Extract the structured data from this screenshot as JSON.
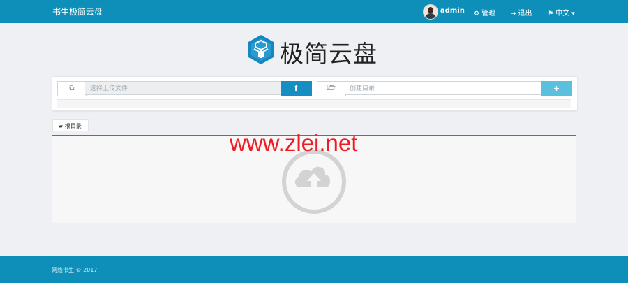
{
  "navbar": {
    "brand": "书生极简云盘",
    "user": "admin",
    "manage": "管理",
    "logout": "退出",
    "language": "中文"
  },
  "logo": {
    "title": "极简云盘"
  },
  "upload": {
    "file_placeholder": "选择上传文件",
    "dir_placeholder": "创建目录"
  },
  "tabs": {
    "root": "根目录"
  },
  "watermark": "www.zlei.net",
  "footer": {
    "text": "网络书生 © 2017"
  },
  "colors": {
    "navbar": "#0e8fb9",
    "upload_button": "#168ec2",
    "create_button": "#5bc0de",
    "watermark": "#ee1d23"
  },
  "icons": [
    "user-avatar",
    "cog-icon",
    "sign-out-icon",
    "flag-icon",
    "chevron-down-icon",
    "copy-icon",
    "upload-icon",
    "folder-open-icon",
    "plus-icon",
    "folder-icon",
    "cloud-upload-icon"
  ]
}
